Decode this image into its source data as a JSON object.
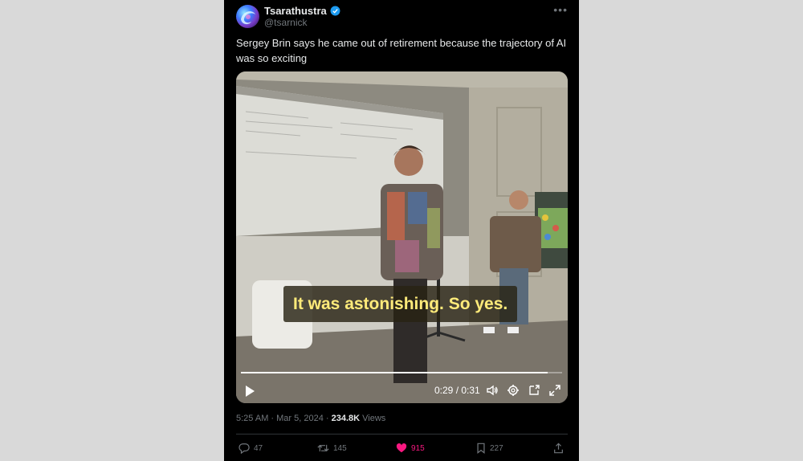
{
  "author": {
    "display_name": "Tsarathustra",
    "handle": "@tsarnick",
    "verified_icon": "verified-badge-icon"
  },
  "tweet": {
    "text": "Sergey Brin says he came out of retirement because the trajectory of AI was so exciting"
  },
  "video": {
    "caption": "It was astonishing. So yes.",
    "time": "0:29 / 0:31",
    "progress": 0.955
  },
  "meta": {
    "time": "5:25 AM",
    "sep": " · ",
    "date": "Mar 5, 2024",
    "sep2": " · ",
    "views_count": "234.8K",
    "views_label": " Views"
  },
  "actions": {
    "replies": "47",
    "reposts": "145",
    "likes": "915",
    "bookmarks": "227"
  },
  "colors": {
    "like": "#f91880",
    "verified": "#1d9bf0",
    "caption": "#ffeb7a"
  }
}
